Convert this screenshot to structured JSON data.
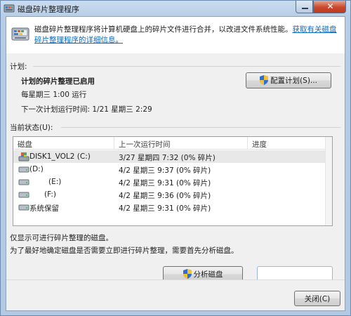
{
  "window": {
    "title": "磁盘碎片整理程序"
  },
  "intro": {
    "text": "磁盘碎片整理程序将计算机硬盘上的碎片文件进行合并，以改进文件系统性能。",
    "link": "获取有关磁盘碎片整理程序的详细信息。"
  },
  "schedule": {
    "section_label": "计划:",
    "status": "计划的碎片整理已启用",
    "frequency": "每星期三  1:00 运行",
    "next_run": "下一次计划运行时间: 1/21 星期三 2:29",
    "configure_button": "配置计划(S)..."
  },
  "current_status": {
    "section_label": "当前状态(U):",
    "columns": [
      "磁盘",
      "上一次运行时间",
      "进度"
    ],
    "rows": [
      {
        "disk": "DISK1_VOL2 (C:)",
        "last_run": "3/27 星期四 7:32 (0% 碎片)",
        "progress": "",
        "icon": "system-drive-icon"
      },
      {
        "disk": "(D:)",
        "last_run": "4/2 星期三 9:37 (0% 碎片)",
        "progress": "",
        "icon": "drive-icon"
      },
      {
        "disk": "(E:)",
        "last_run": "4/2 星期三 9:31 (0% 碎片)",
        "progress": "",
        "icon": "drive-icon"
      },
      {
        "disk": "(F:)",
        "last_run": "4/2 星期三 9:36 (0% 碎片)",
        "progress": "",
        "icon": "drive-icon"
      },
      {
        "disk": "系统保留",
        "last_run": "4/2 星期三 9:31 (0% 碎片)",
        "progress": "",
        "icon": "drive-icon"
      }
    ]
  },
  "notes": {
    "line1": "仅显示可进行碎片整理的磁盘。",
    "line2": "为了最好地确定磁盘是否需要立即进行碎片整理，需要首先分析磁盘。"
  },
  "buttons": {
    "analyze": "分析磁盘",
    "close": "关闭(C)"
  },
  "colors": {
    "link": "#0b6bc8",
    "title_bar": "#b7cde6",
    "close_button": "#c9482b"
  }
}
